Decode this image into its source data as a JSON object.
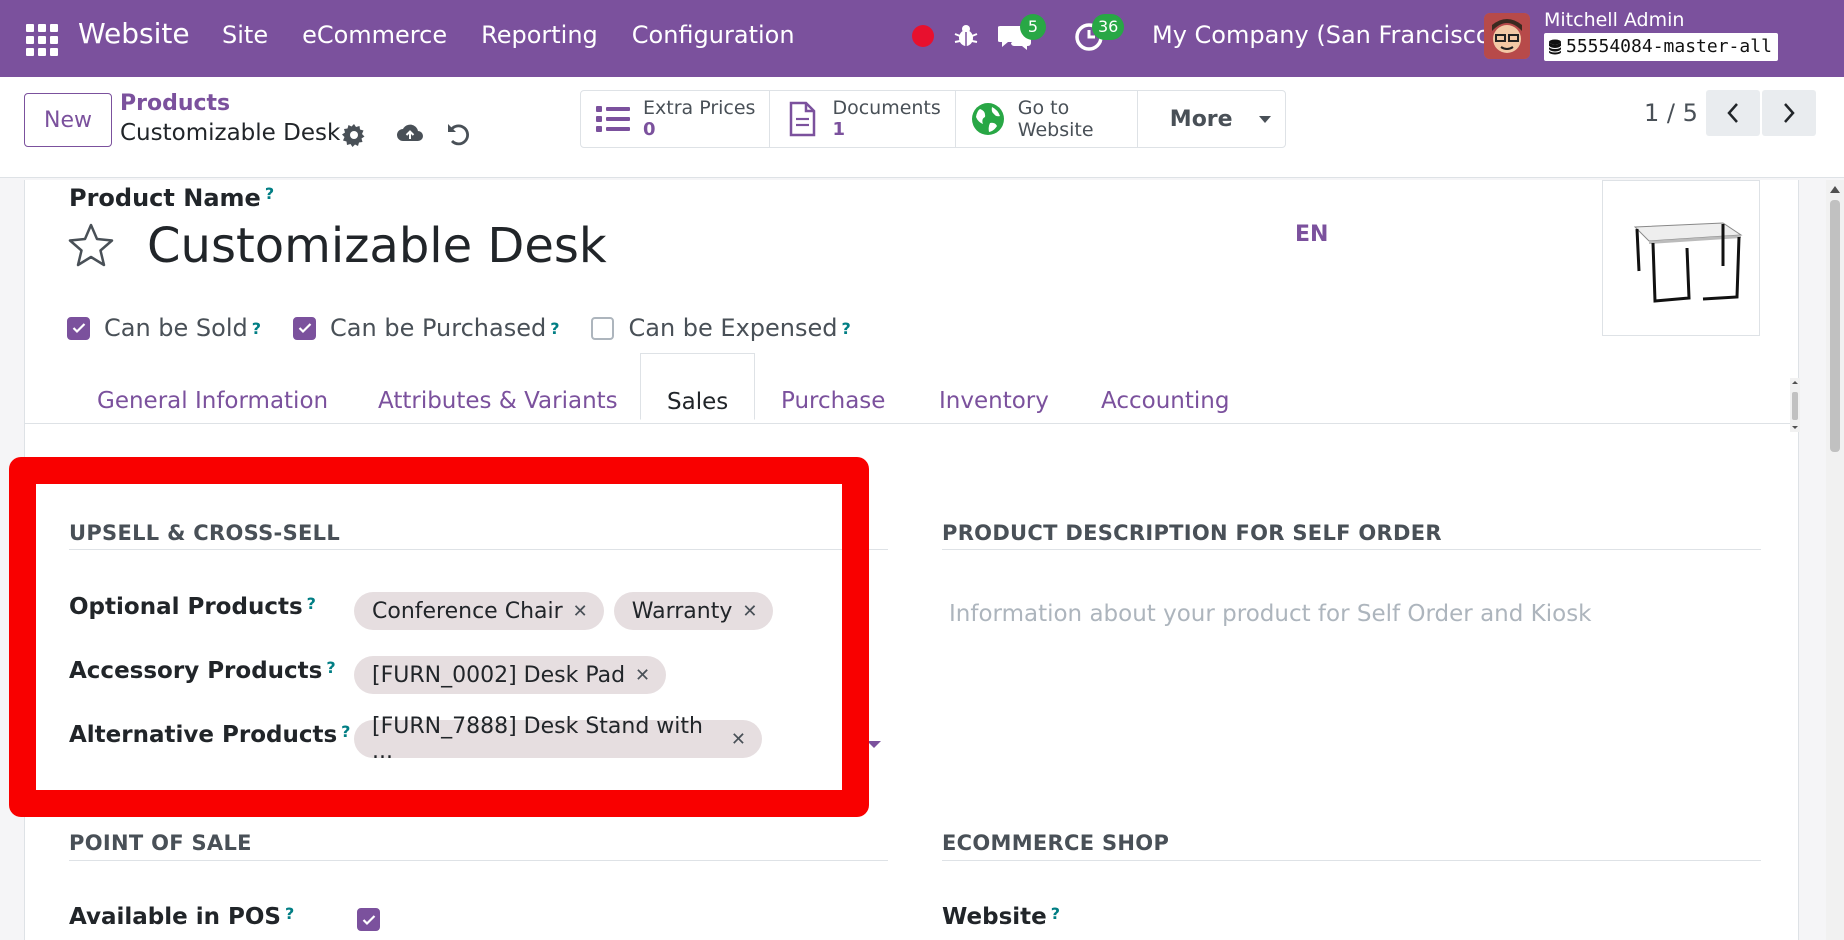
{
  "navbar": {
    "app_name": "Website",
    "menu": [
      "Site",
      "eCommerce",
      "Reporting",
      "Configuration"
    ],
    "chat_count": "5",
    "activity_count": "36",
    "company": "My Company (San Francisco)",
    "user_name": "Mitchell Admin",
    "database": "55554084-master-all",
    "brand_color": "#7b519d"
  },
  "control": {
    "new_label": "New",
    "breadcrumb_parent": "Products",
    "breadcrumb_current": "Customizable Desk",
    "smart_buttons": [
      {
        "label": "Extra Prices",
        "value": "0",
        "icon": "list-icon"
      },
      {
        "label": "Documents",
        "value": "1",
        "icon": "document-icon"
      },
      {
        "label": "Go to",
        "value": "Website",
        "icon": "globe-icon"
      }
    ],
    "more_label": "More",
    "pager": "1 / 5"
  },
  "form": {
    "product_name_label": "Product Name",
    "help_mark": "?",
    "product_name": "Customizable Desk",
    "lang": "EN",
    "checkboxes": [
      {
        "label": "Can be Sold",
        "checked": true
      },
      {
        "label": "Can be Purchased",
        "checked": true
      },
      {
        "label": "Can be Expensed",
        "checked": false
      }
    ],
    "tabs": [
      "General Information",
      "Attributes & Variants",
      "Sales",
      "Purchase",
      "Inventory",
      "Accounting"
    ],
    "active_tab": "Sales"
  },
  "upsell": {
    "title": "UPSELL & CROSS-SELL",
    "optional_label": "Optional Products",
    "optional_tags": [
      "Conference Chair",
      "Warranty"
    ],
    "accessory_label": "Accessory Products",
    "accessory_tags": [
      "[FURN_0002] Desk Pad"
    ],
    "alternative_label": "Alternative Products",
    "alternative_tags": [
      "[FURN_7888] Desk Stand with ..."
    ]
  },
  "self_order": {
    "title": "PRODUCT DESCRIPTION FOR SELF ORDER",
    "placeholder": "Information about your product for Self Order and Kiosk"
  },
  "pos": {
    "title": "POINT OF SALE",
    "available_label": "Available in POS",
    "available": true
  },
  "ecommerce": {
    "title": "ECOMMERCE SHOP",
    "website_label": "Website"
  },
  "annotation": {
    "highlight_color": "#f90000"
  }
}
